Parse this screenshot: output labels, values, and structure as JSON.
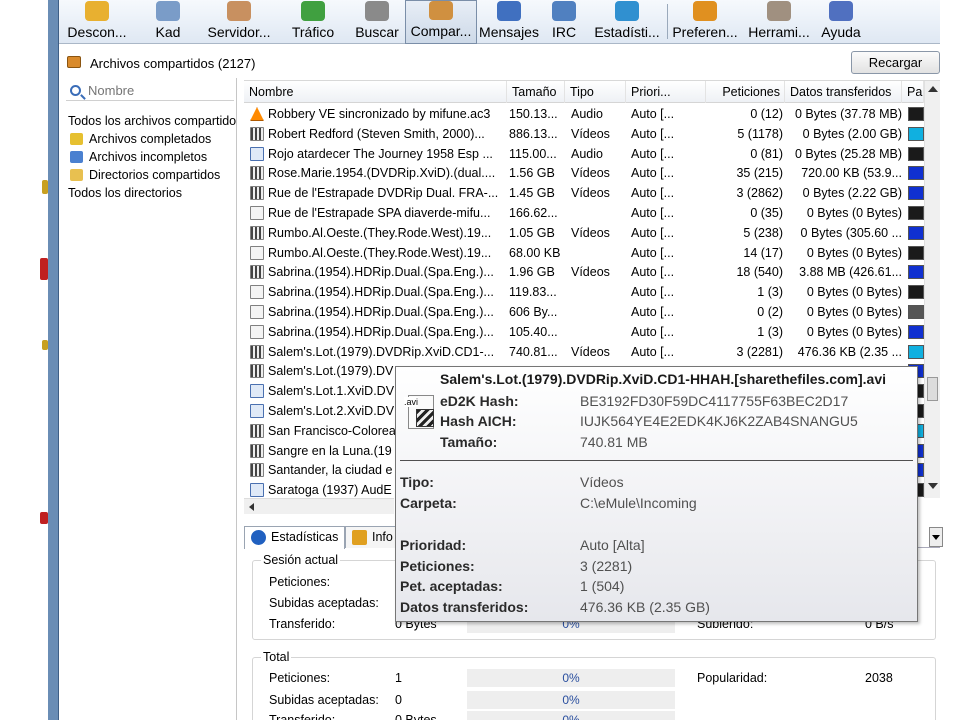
{
  "toolbar": {
    "buttons": [
      {
        "id": "desconectar",
        "label": "Descon...",
        "color": "#e8b030"
      },
      {
        "id": "kad",
        "label": "Kad",
        "color": "#7a9cc8"
      },
      {
        "id": "servidores",
        "label": "Servidor...",
        "color": "#c89060"
      },
      {
        "id": "trafico",
        "label": "Tráfico",
        "color": "#40a040"
      },
      {
        "id": "buscar",
        "label": "Buscar",
        "color": "#8a8a8a"
      },
      {
        "id": "compartidos",
        "label": "Compar...",
        "color": "#d09040",
        "active": true
      },
      {
        "id": "mensajes",
        "label": "Mensajes",
        "color": "#4070c0"
      },
      {
        "id": "irc",
        "label": "IRC",
        "color": "#5080c0"
      },
      {
        "id": "estadisticas",
        "label": "Estadísti...",
        "color": "#3090d0"
      },
      {
        "id": "preferencias",
        "label": "Preferen...",
        "color": "#e09020"
      },
      {
        "id": "herramientas",
        "label": "Herrami...",
        "color": "#a09080"
      },
      {
        "id": "ayuda",
        "label": "Ayuda",
        "color": "#5070c0"
      }
    ]
  },
  "header": {
    "title": "Archivos compartidos (2127)",
    "reload_label": "Recargar"
  },
  "sidebar": {
    "search_placeholder": "Nombre",
    "tree": [
      {
        "label": "Todos los archivos compartidos",
        "icon": "none",
        "indent": false
      },
      {
        "label": "Archivos completados",
        "icon": "check-folder-icon",
        "color": "#e6c030",
        "indent": true
      },
      {
        "label": "Archivos incompletos",
        "icon": "partial-folder-icon",
        "color": "#4a80d0",
        "indent": true
      },
      {
        "label": "Directorios compartidos",
        "icon": "folder-icon",
        "color": "#e8c050",
        "indent": true
      },
      {
        "label": "Todos los directorios",
        "icon": "none",
        "indent": false
      }
    ]
  },
  "table": {
    "columns": [
      "Nombre",
      "Tamaño",
      "Tipo",
      "Priori...",
      "Peticiones",
      "Datos transferidos",
      "Par"
    ],
    "rows": [
      {
        "name": "Robbery VE sincronizado by mifune.ac3",
        "size": "150.13...",
        "type": "Audio",
        "priority": "Auto [...",
        "requests": "0 (12)",
        "transferred": "0 Bytes (37.78 MB)",
        "icon": "vlc",
        "bar": "#1a1a1a"
      },
      {
        "name": "Robert Redford (Steven Smith, 2000)...",
        "size": "886.13...",
        "type": "Vídeos",
        "priority": "Auto [...",
        "requests": "5 (1178)",
        "transferred": "0 Bytes (2.00 GB)",
        "icon": "video",
        "bar": "#10b0e0"
      },
      {
        "name": "Rojo atardecer The Journey 1958 Esp ...",
        "size": "115.00...",
        "type": "Audio",
        "priority": "Auto [...",
        "requests": "0 (81)",
        "transferred": "0 Bytes (25.28 MB)",
        "icon": "audio",
        "bar": "#1a1a1a"
      },
      {
        "name": "Rose.Marie.1954.(DVDRip.XviD).(dual....",
        "size": "1.56 GB",
        "type": "Vídeos",
        "priority": "Auto [...",
        "requests": "35 (215)",
        "transferred": "720.00 KB (53.9...",
        "icon": "video",
        "bar": "#1030d0"
      },
      {
        "name": "Rue de l'Estrapade DVDRip Dual. FRA-...",
        "size": "1.45 GB",
        "type": "Vídeos",
        "priority": "Auto [...",
        "requests": "3 (2862)",
        "transferred": "0 Bytes (2.22 GB)",
        "icon": "video",
        "bar": "#1030d0"
      },
      {
        "name": "Rue de l'Estrapade SPA diaverde-mifu...",
        "size": "166.62...",
        "type": "",
        "priority": "Auto [...",
        "requests": "0 (35)",
        "transferred": "0 Bytes (0 Bytes)",
        "icon": "generic",
        "bar": "#1a1a1a"
      },
      {
        "name": "Rumbo.Al.Oeste.(They.Rode.West).19...",
        "size": "1.05 GB",
        "type": "Vídeos",
        "priority": "Auto [...",
        "requests": "5 (238)",
        "transferred": "0 Bytes (305.60 ...",
        "icon": "video",
        "bar": "#1030d0"
      },
      {
        "name": "Rumbo.Al.Oeste.(They.Rode.West).19...",
        "size": "68.00 KB",
        "type": "",
        "priority": "Auto [...",
        "requests": "14 (17)",
        "transferred": "0 Bytes (0 Bytes)",
        "icon": "generic",
        "bar": "#1a1a1a"
      },
      {
        "name": "Sabrina.(1954).HDRip.Dual.(Spa.Eng.)...",
        "size": "1.96 GB",
        "type": "Vídeos",
        "priority": "Auto [...",
        "requests": "18 (540)",
        "transferred": "3.88 MB (426.61...",
        "icon": "video",
        "bar": "#1030d0"
      },
      {
        "name": "Sabrina.(1954).HDRip.Dual.(Spa.Eng.)...",
        "size": "119.83...",
        "type": "",
        "priority": "Auto [...",
        "requests": "1 (3)",
        "transferred": "0 Bytes (0 Bytes)",
        "icon": "generic",
        "bar": "#1a1a1a"
      },
      {
        "name": "Sabrina.(1954).HDRip.Dual.(Spa.Eng.)...",
        "size": "606 By...",
        "type": "",
        "priority": "Auto [...",
        "requests": "0 (2)",
        "transferred": "0 Bytes (0 Bytes)",
        "icon": "generic",
        "bar": "#555555"
      },
      {
        "name": "Sabrina.(1954).HDRip.Dual.(Spa.Eng.)...",
        "size": "105.40...",
        "type": "",
        "priority": "Auto [...",
        "requests": "1 (3)",
        "transferred": "0 Bytes (0 Bytes)",
        "icon": "generic",
        "bar": "#1030d0"
      },
      {
        "name": "Salem's.Lot.(1979).DVDRip.XviD.CD1-...",
        "size": "740.81...",
        "type": "Vídeos",
        "priority": "Auto [...",
        "requests": "3 (2281)",
        "transferred": "476.36 KB (2.35 ...",
        "icon": "video",
        "bar": "#10b0e0"
      },
      {
        "name": "Salem's.Lot.(1979).DV",
        "size": "",
        "type": "",
        "priority": "",
        "requests": "",
        "transferred": "",
        "icon": "video",
        "bar": "#1030d0"
      },
      {
        "name": "Salem's.Lot.1.XviD.DV",
        "size": "",
        "type": "",
        "priority": "",
        "requests": "",
        "transferred": "",
        "icon": "audio",
        "bar": "#1a1a1a"
      },
      {
        "name": "Salem's.Lot.2.XviD.DV",
        "size": "",
        "type": "",
        "priority": "",
        "requests": "",
        "transferred": "",
        "icon": "audio",
        "bar": "#1a1a1a"
      },
      {
        "name": "San Francisco-Colorea",
        "size": "",
        "type": "",
        "priority": "",
        "requests": "",
        "transferred": "",
        "icon": "video",
        "bar": "#10b0e0"
      },
      {
        "name": "Sangre en la Luna.(19",
        "size": "",
        "type": "",
        "priority": "",
        "requests": "",
        "transferred": "",
        "icon": "video",
        "bar": "#1030d0"
      },
      {
        "name": "Santander, la ciudad e",
        "size": "",
        "type": "",
        "priority": "",
        "requests": "",
        "transferred": "",
        "icon": "video",
        "bar": "#1030d0"
      },
      {
        "name": "Saratoga (1937) AudE",
        "size": "",
        "type": "",
        "priority": "",
        "requests": "",
        "transferred": "",
        "icon": "audio",
        "bar": "#1a1a1a"
      }
    ]
  },
  "tabs": [
    {
      "label": "Estadísticas",
      "selected": true,
      "color": "#2060c0"
    },
    {
      "label": "Info",
      "selected": false,
      "color": "#e0a020"
    }
  ],
  "stats": {
    "session_title": "Sesión actual",
    "session": {
      "requests_label": "Peticiones:",
      "accepted_label": "Subidas aceptadas:",
      "transferred_label": "Transferido:",
      "transferred_value": "0 Bytes",
      "transferred_pct": "0%",
      "uploading_label": "Subiendo:",
      "uploading_value": "0 B/s"
    },
    "total_title": "Total",
    "total": {
      "requests_label": "Peticiones:",
      "requests_value": "1",
      "requests_pct": "0%",
      "accepted_label": "Subidas aceptadas:",
      "accepted_value": "0",
      "accepted_pct": "0%",
      "transferred_label": "Transferido:",
      "transferred_value": "0 Bytes",
      "transferred_pct": "0%",
      "popularity_label": "Popularidad:",
      "popularity_value": "2038"
    }
  },
  "tooltip": {
    "filename": "Salem's.Lot.(1979).DVDRip.XviD.CD1-HHAH.[sharethefiles.com].avi",
    "icon_ext": ".avi",
    "ed2k_label": "eD2K Hash:",
    "ed2k_value": "BE3192FD30F59DC4117755F63BEC2D17",
    "aich_label": "Hash AICH:",
    "aich_value": "IUJK564YE4E2EDK4KJ6K2ZAB4SNANGU5",
    "size_label": "Tamaño:",
    "size_value": "740.81 MB",
    "type_label": "Tipo:",
    "type_value": "Vídeos",
    "folder_label": "Carpeta:",
    "folder_value": "C:\\eMule\\Incoming",
    "priority_label": "Prioridad:",
    "priority_value": "Auto [Alta]",
    "requests_label": "Peticiones:",
    "requests_value": "3 (2281)",
    "accepted_label": "Pet. aceptadas:",
    "accepted_value": "1 (504)",
    "transferred_label": "Datos transferidos:",
    "transferred_value": "476.36 KB (2.35 GB)"
  }
}
